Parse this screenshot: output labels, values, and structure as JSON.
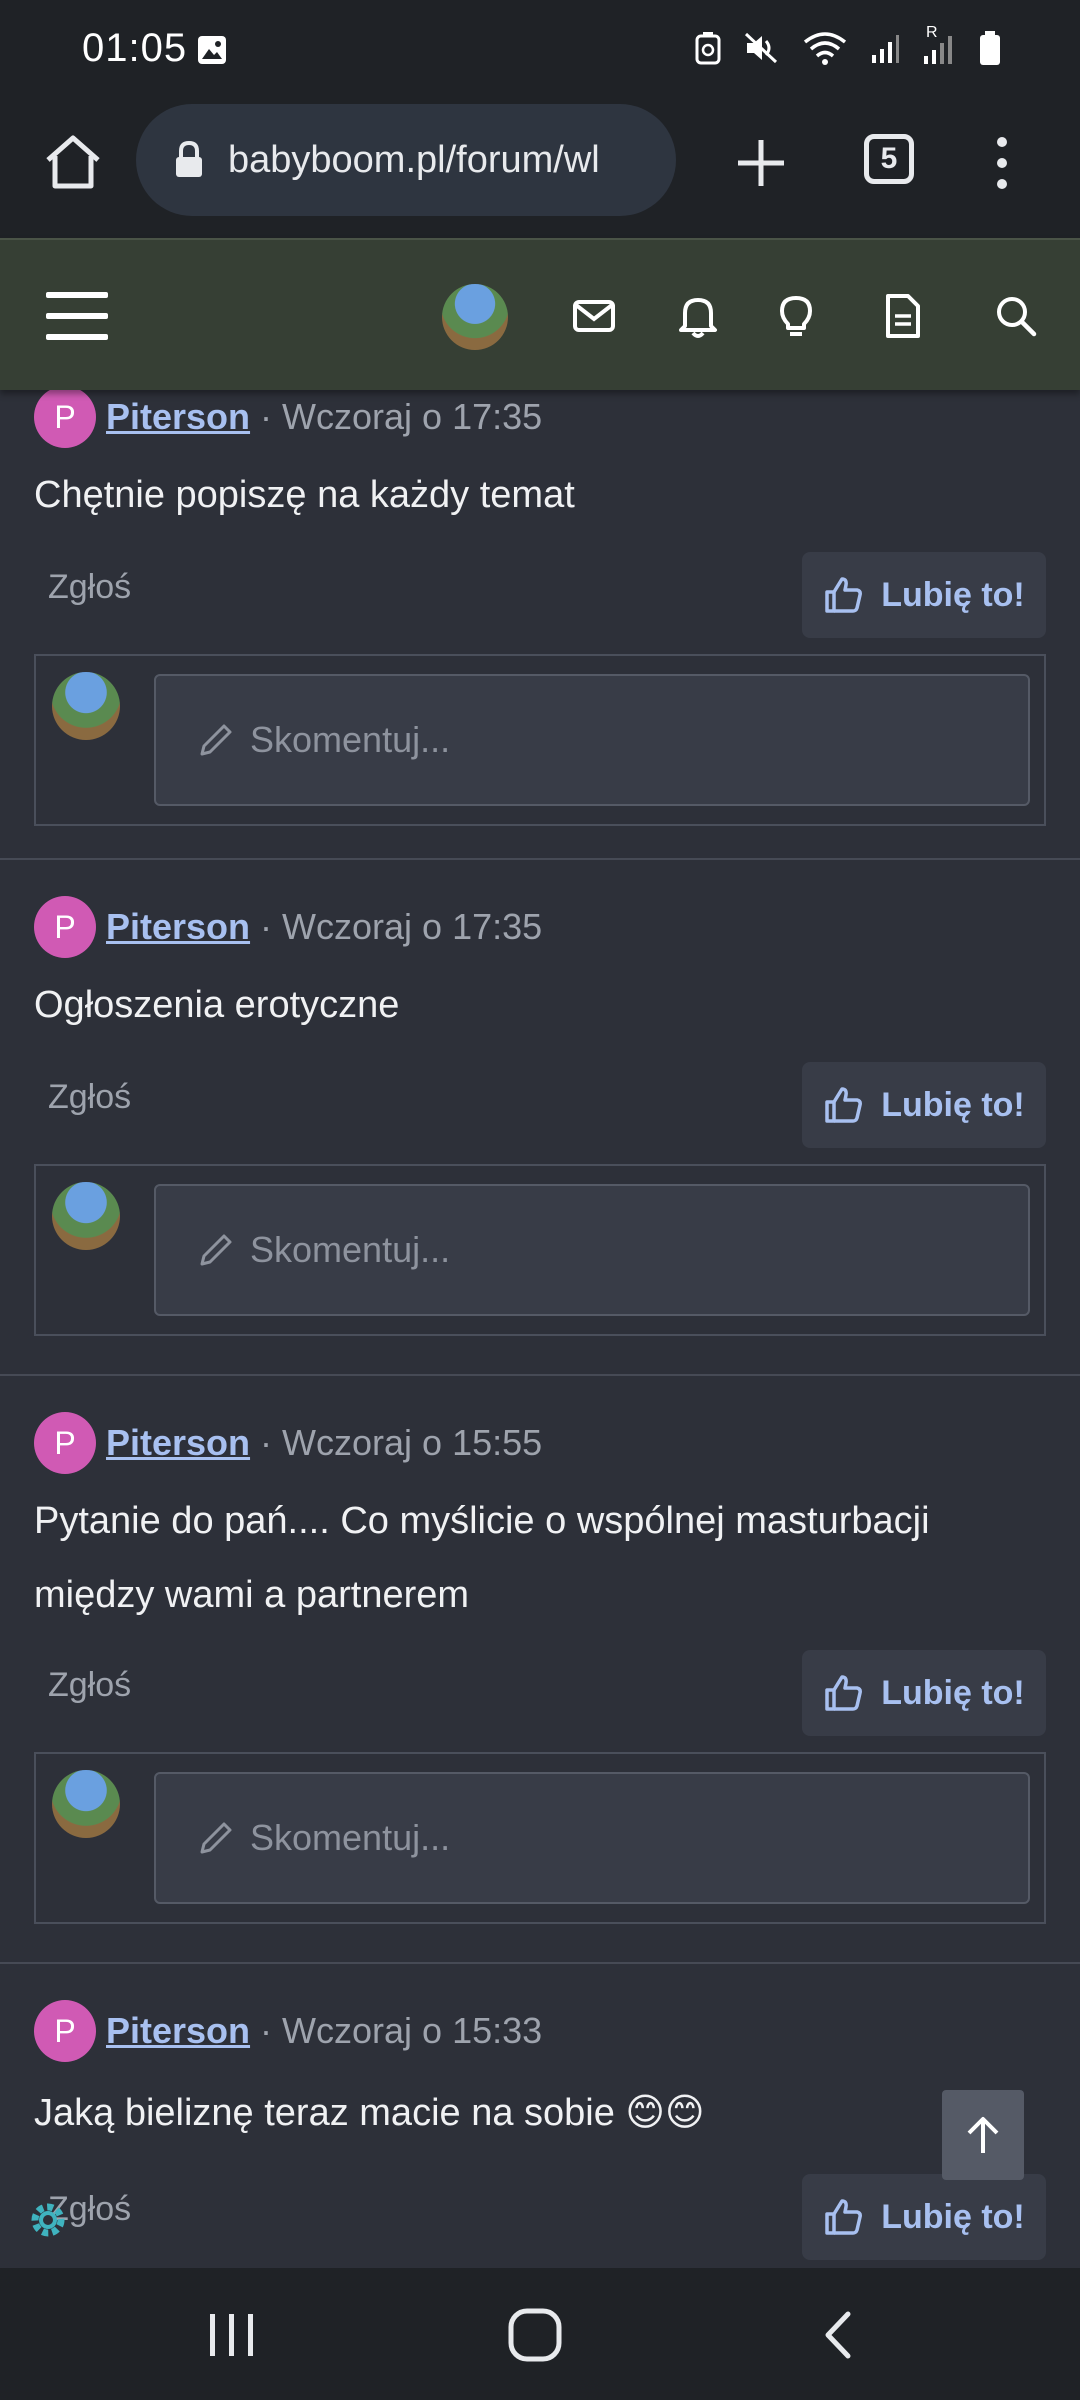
{
  "status_bar": {
    "time": "01:05",
    "signal_label": "R"
  },
  "browser": {
    "url": "babyboom.pl/forum/wl",
    "tab_count": "5"
  },
  "posts": [
    {
      "user_initial": "P",
      "user": "Piterson",
      "time": "· Wczoraj o 17:35",
      "text": "Chętnie popiszę na każdy temat",
      "report": "Zgłoś",
      "like": "Lubię to!",
      "comment_placeholder": "Skomentuj..."
    },
    {
      "user_initial": "P",
      "user": "Piterson",
      "time": "· Wczoraj o 17:35",
      "text": "Ogłoszenia erotyczne",
      "report": "Zgłoś",
      "like": "Lubię to!",
      "comment_placeholder": "Skomentuj..."
    },
    {
      "user_initial": "P",
      "user": "Piterson",
      "time": "· Wczoraj o 15:55",
      "text": "Pytanie do pań.... Co myślicie o wspólnej masturbacji między wami a partnerem",
      "report": "Zgłoś",
      "like": "Lubię to!",
      "comment_placeholder": "Skomentuj..."
    },
    {
      "user_initial": "P",
      "user": "Piterson",
      "time": "· Wczoraj o 15:33",
      "text": "Jaką bieliznę teraz macie na sobie 😊😊",
      "report": "Zgłoś",
      "like": "Lubię to!"
    }
  ],
  "colors": {
    "accent": "#a8c0f0",
    "header_bg": "#363f34",
    "avatar_bg": "#d05ab4",
    "page_bg": "#2d3039"
  }
}
